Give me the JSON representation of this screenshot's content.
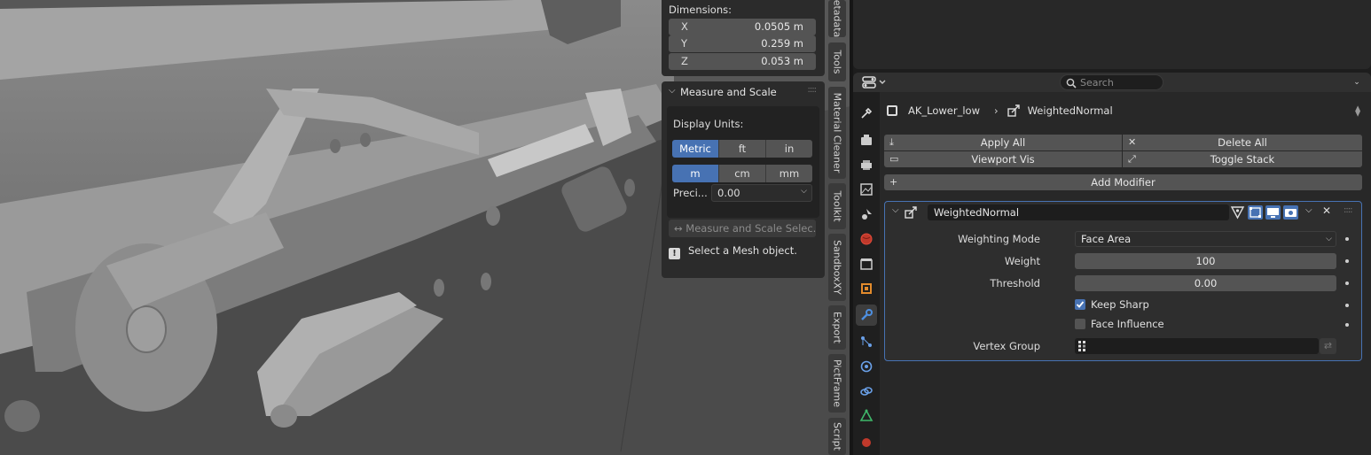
{
  "viewport": {
    "dimensions": {
      "title": "Dimensions:",
      "rows": [
        {
          "axis": "X",
          "value": "0.0505 m"
        },
        {
          "axis": "Y",
          "value": "0.259 m"
        },
        {
          "axis": "Z",
          "value": "0.053 m"
        }
      ]
    },
    "measure_scale": {
      "title": "Measure and Scale",
      "display_units_label": "Display Units:",
      "unit_systems": [
        "Metric",
        "ft",
        "in"
      ],
      "active_unit_system": "Metric",
      "length_units": [
        "m",
        "cm",
        "mm"
      ],
      "active_length_unit": "m",
      "precision_label": "Preci...",
      "precision_value": "0.00",
      "action_button": "Measure and Scale Selec...",
      "info_message": "Select a Mesh object."
    },
    "sidebar_tabs": [
      "etadata",
      "Tools",
      "Material Cleaner",
      "Toolkit",
      "SandboxXY",
      "Export",
      "PictFrame",
      "Script"
    ]
  },
  "properties": {
    "search_placeholder": "Search",
    "breadcrumb": {
      "object": "AK_Lower_low",
      "modifier": "WeightedNormal"
    },
    "tabs": [
      "tool",
      "render",
      "output",
      "view-layer",
      "scene",
      "world",
      "collection",
      "object",
      "modifiers",
      "particles",
      "physics",
      "constraints",
      "data",
      "material"
    ],
    "active_tab": "modifiers",
    "buttons": {
      "apply_all": "Apply All",
      "delete_all": "Delete All",
      "viewport_vis": "Viewport Vis",
      "toggle_stack": "Toggle Stack",
      "add_modifier": "Add Modifier"
    },
    "modifier": {
      "name": "WeightedNormal",
      "weighting_mode_label": "Weighting Mode",
      "weighting_mode_value": "Face Area",
      "weight_label": "Weight",
      "weight_value": "100",
      "threshold_label": "Threshold",
      "threshold_value": "0.00",
      "keep_sharp_label": "Keep Sharp",
      "keep_sharp": true,
      "face_influence_label": "Face Influence",
      "face_influence": false,
      "vertex_group_label": "Vertex Group",
      "vertex_group_value": ""
    }
  },
  "colors": {
    "accent": "#4772b3",
    "panel_bg": "#282828",
    "field_bg": "#545454"
  }
}
